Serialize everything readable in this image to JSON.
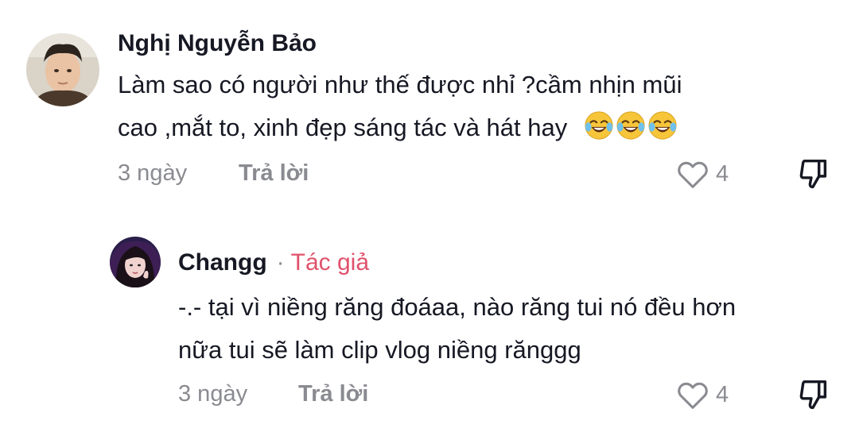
{
  "comments": [
    {
      "username": "Nghị Nguyễn Bảo",
      "text_line1": "Làm sao có người như thế được nhỉ ?cầm nhịn mũi",
      "text_line2": "cao ,mắt to, xinh đẹp sáng tác và hát hay",
      "emojis": [
        "face-with-tears-of-joy",
        "face-with-tears-of-joy",
        "face-with-tears-of-joy"
      ],
      "time": "3 ngày",
      "reply_label": "Trả lời",
      "likes": "4"
    },
    {
      "username": "Changg",
      "separator": "·",
      "author_tag": "Tác giả",
      "text_line1": "-.- tại vì niềng răng đoáaa, nào răng tui nó đều hơn",
      "text_line2": "nữa tui sẽ làm clip vlog niềng rănggg",
      "time": "3 ngày",
      "reply_label": "Trả lời",
      "likes": "4"
    }
  ],
  "colors": {
    "muted": "#8a8b91",
    "author_tag": "#e0526b",
    "text": "#161823"
  }
}
